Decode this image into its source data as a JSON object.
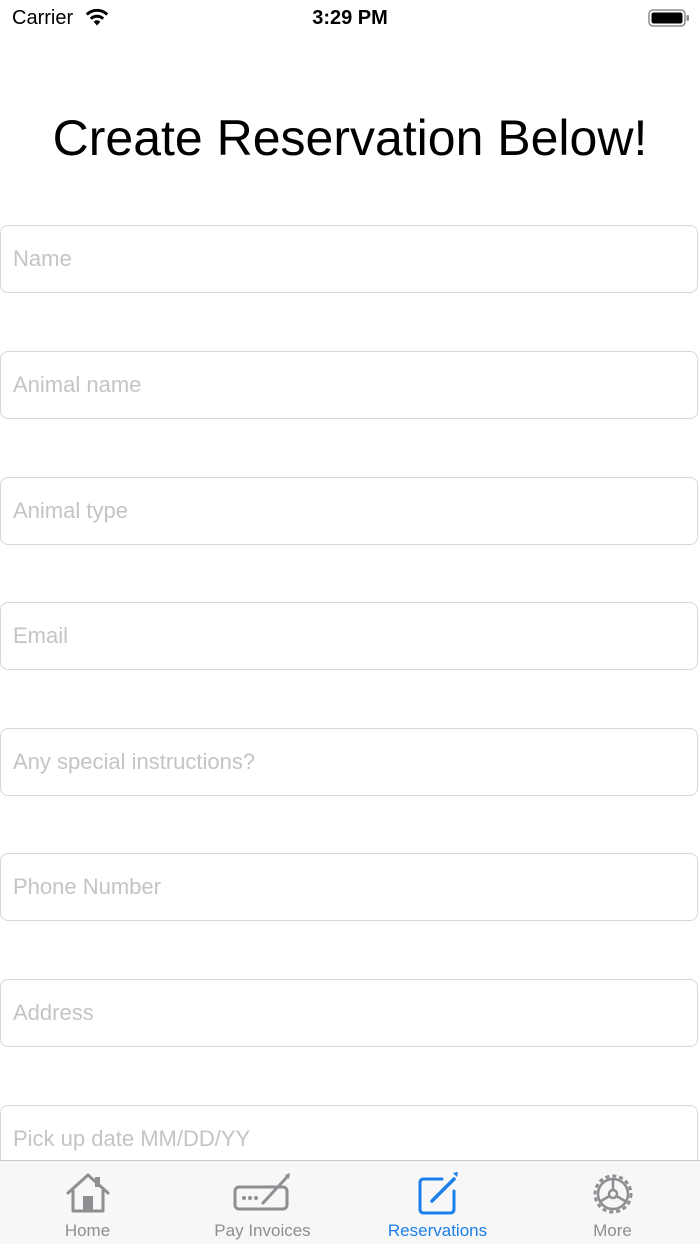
{
  "status_bar": {
    "carrier": "Carrier",
    "time": "3:29 PM",
    "wifi_icon": "wifi-icon",
    "battery_icon": "battery-icon"
  },
  "page": {
    "title": "Create Reservation Below!"
  },
  "form": {
    "fields": [
      {
        "placeholder": "Name",
        "value": ""
      },
      {
        "placeholder": "Animal name",
        "value": ""
      },
      {
        "placeholder": "Animal type",
        "value": ""
      },
      {
        "placeholder": "Email",
        "value": ""
      },
      {
        "placeholder": "Any special instructions?",
        "value": ""
      },
      {
        "placeholder": "Phone Number",
        "value": ""
      },
      {
        "placeholder": "Address",
        "value": ""
      },
      {
        "placeholder": "Pick up date MM/DD/YY",
        "value": ""
      }
    ]
  },
  "tab_bar": {
    "active_color": "#1a7fe8",
    "inactive_color": "#8e8e93",
    "tabs": [
      {
        "label": "Home",
        "icon": "home-icon",
        "active": false
      },
      {
        "label": "Pay Invoices",
        "icon": "signature-icon",
        "active": false
      },
      {
        "label": "Reservations",
        "icon": "compose-icon",
        "active": true
      },
      {
        "label": "More",
        "icon": "gear-icon",
        "active": false
      }
    ]
  }
}
